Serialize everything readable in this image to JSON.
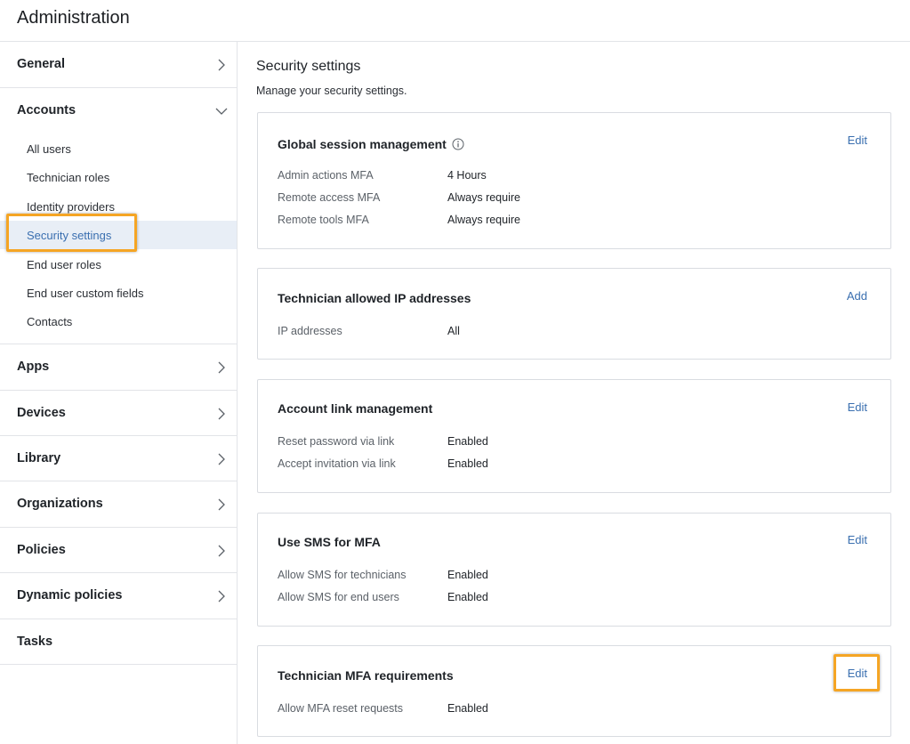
{
  "header": {
    "title": "Administration"
  },
  "sidebar": {
    "groups": [
      {
        "label": "General"
      },
      {
        "label": "Accounts",
        "items": [
          {
            "label": "All users"
          },
          {
            "label": "Technician roles"
          },
          {
            "label": "Identity providers"
          },
          {
            "label": "Security settings",
            "active": true
          },
          {
            "label": "End user roles"
          },
          {
            "label": "End user custom fields"
          },
          {
            "label": "Contacts"
          }
        ]
      },
      {
        "label": "Apps"
      },
      {
        "label": "Devices"
      },
      {
        "label": "Library"
      },
      {
        "label": "Organizations"
      },
      {
        "label": "Policies"
      },
      {
        "label": "Dynamic policies"
      },
      {
        "label": "Tasks"
      }
    ]
  },
  "main": {
    "title": "Security settings",
    "subtitle": "Manage your security settings.",
    "cards": [
      {
        "title": "Global session management",
        "action": "Edit",
        "rows": [
          {
            "label": "Admin actions MFA",
            "value": "4 Hours"
          },
          {
            "label": "Remote access MFA",
            "value": "Always require"
          },
          {
            "label": "Remote tools MFA",
            "value": "Always require"
          }
        ]
      },
      {
        "title": "Technician allowed IP addresses",
        "action": "Add",
        "rows": [
          {
            "label": "IP addresses",
            "value": "All"
          }
        ]
      },
      {
        "title": "Account link management",
        "action": "Edit",
        "rows": [
          {
            "label": "Reset password via link",
            "value": "Enabled"
          },
          {
            "label": "Accept invitation via link",
            "value": "Enabled"
          }
        ]
      },
      {
        "title": "Use SMS for MFA",
        "action": "Edit",
        "rows": [
          {
            "label": "Allow SMS for technicians",
            "value": "Enabled"
          },
          {
            "label": "Allow SMS for end users",
            "value": "Enabled"
          }
        ]
      },
      {
        "title": "Technician MFA requirements",
        "action": "Edit",
        "rows": [
          {
            "label": "Allow MFA reset requests",
            "value": "Enabled"
          }
        ]
      }
    ]
  },
  "colors": {
    "accent": "#3a6fb0",
    "highlight": "#f5a524",
    "active_bg": "#e8eef6"
  }
}
